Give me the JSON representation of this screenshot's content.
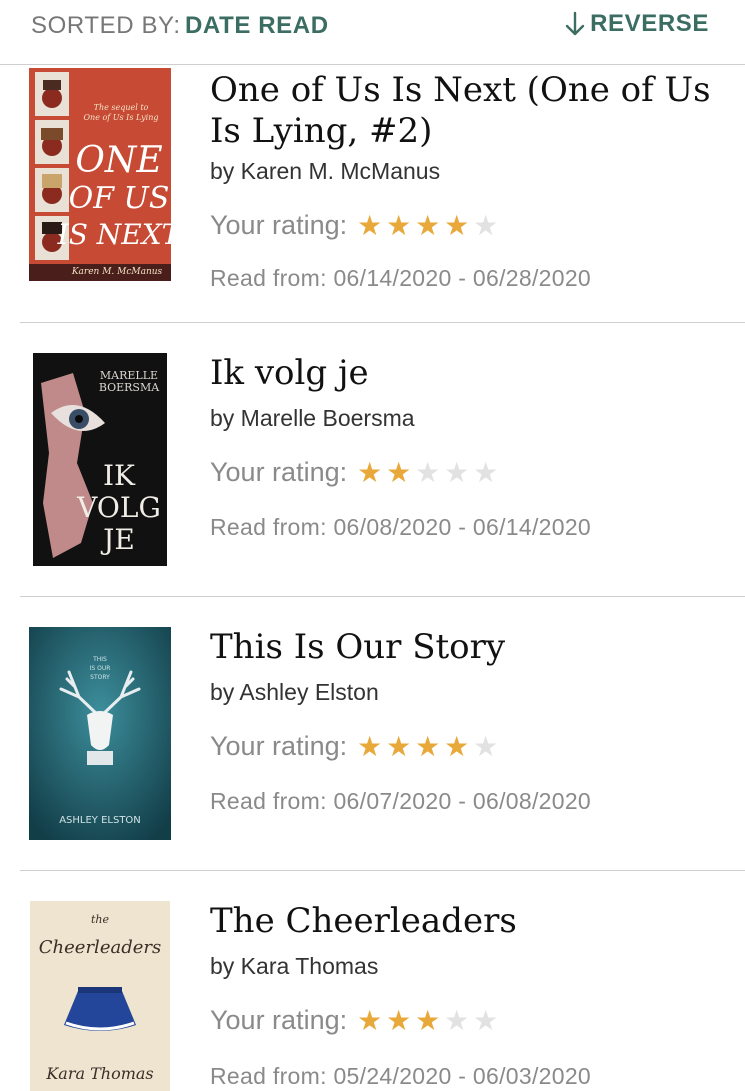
{
  "sort": {
    "label": "SORTED BY:",
    "value": "DATE READ",
    "reverse_label": "REVERSE",
    "accent": "#3b6d63"
  },
  "rating_label": "Your rating:",
  "colors": {
    "star_on": "#e8a93a",
    "star_off": "#e2e2e2"
  },
  "books": [
    {
      "title": "One of Us Is Next (One of Us Is Lying, #2)",
      "author": "by Karen M. McManus",
      "rating": 4,
      "read": "Read from: 06/14/2020 - 06/28/2020",
      "cover": {
        "text_main": "ONE OF US IS NEXT",
        "text_sub": "The sequel to One of Us Is Lying",
        "text_author": "Karen M. McManus",
        "bg": "#c64a34"
      }
    },
    {
      "title": "Ik volg je",
      "author": "by Marelle Boersma",
      "rating": 2,
      "read": "Read from: 06/08/2020 - 06/14/2020",
      "cover": {
        "text_main": "IK VOLG JE",
        "text_author": "MARELLE BOERSMA",
        "bg": "#111111"
      }
    },
    {
      "title": "This Is Our Story",
      "author": "by Ashley Elston",
      "rating": 4,
      "read": "Read from: 06/07/2020 - 06/08/2020",
      "cover": {
        "text_main": "THIS IS OUR STORY",
        "text_author": "ASHLEY ELSTON",
        "bg": "#1f5f6d"
      }
    },
    {
      "title": "The Cheerleaders",
      "author": "by Kara Thomas",
      "rating": 3,
      "read": "Read from: 05/24/2020 - 06/03/2020",
      "cover": {
        "text_main": "the Cheerleaders",
        "text_author": "Kara Thomas",
        "bg": "#efe4cf"
      }
    }
  ]
}
